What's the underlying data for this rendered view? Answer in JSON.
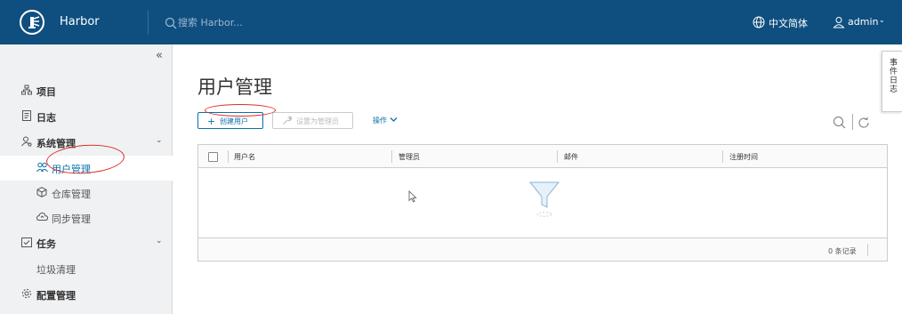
{
  "header": {
    "app_title": "Harbor",
    "search_placeholder": "搜索 Harbor...",
    "language": "中文简体",
    "user": "admin"
  },
  "sidebar": {
    "items": [
      {
        "label": "项目",
        "icon": "project-icon"
      },
      {
        "label": "日志",
        "icon": "log-icon"
      },
      {
        "label": "系统管理",
        "icon": "system-admin-icon",
        "expanded": true
      },
      {
        "label": "用户管理",
        "icon": "users-icon",
        "active": true
      },
      {
        "label": "仓库管理",
        "icon": "registry-icon"
      },
      {
        "label": "同步管理",
        "icon": "cloud-sync-icon"
      },
      {
        "label": "任务",
        "icon": "task-icon",
        "expanded": true
      },
      {
        "label": "垃圾清理"
      },
      {
        "label": "配置管理",
        "icon": "gear-icon"
      }
    ]
  },
  "main": {
    "title": "用户管理",
    "buttons": {
      "new_user": "创建用户",
      "set_admin": "设置为管理员",
      "actions": "操作"
    },
    "table": {
      "columns": [
        "用户名",
        "管理员",
        "邮件",
        "注册时间"
      ],
      "rows": [],
      "footer": "0 条记录"
    }
  },
  "event_log_tab": "事件日志",
  "colors": {
    "header_bg": "#0f4f7f",
    "accent": "#0b6ea8",
    "annotation": "#d9302c"
  }
}
